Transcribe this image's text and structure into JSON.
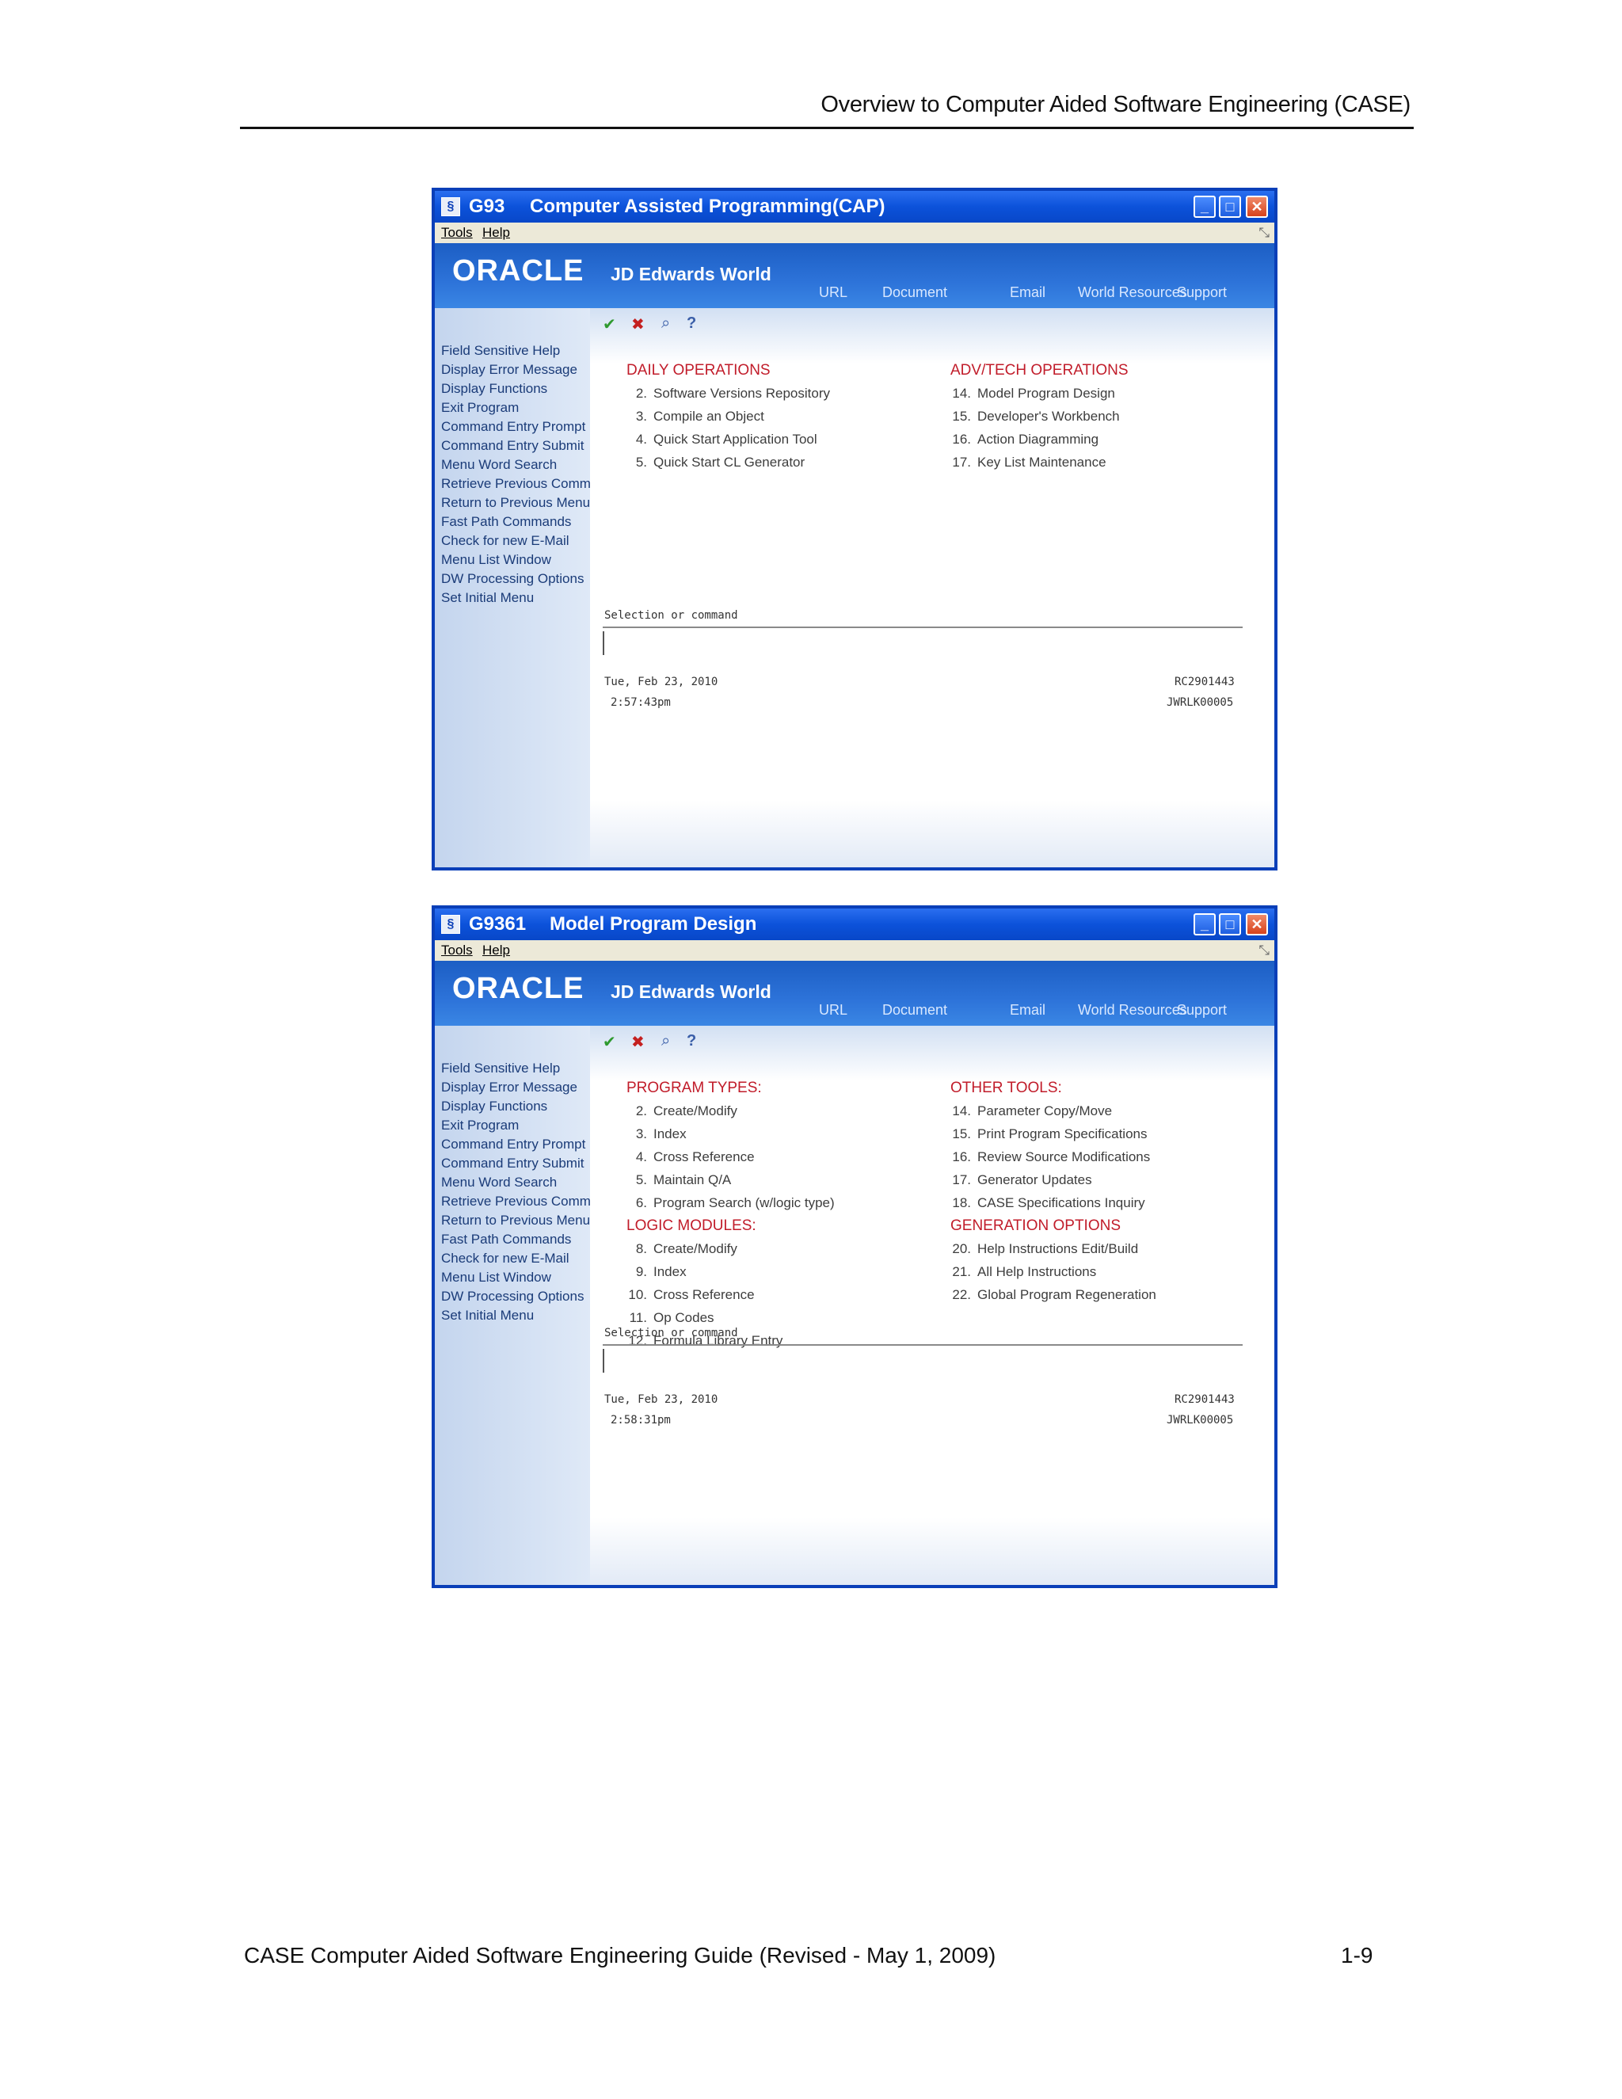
{
  "page": {
    "header": "Overview to Computer Aided Software Engineering (CASE)",
    "footer_left": "CASE Computer Aided Software Engineering Guide (Revised - May 1, 2009)",
    "footer_right": "1-9"
  },
  "common": {
    "menu": {
      "tools": "Tools",
      "help": "Help"
    },
    "brand": {
      "logo": "ORACLE",
      "product": "JD Edwards World"
    },
    "nav": {
      "url": "URL",
      "document": "Document",
      "email": "Email",
      "world_resources": "World Resources",
      "support": "Support"
    },
    "sidebar": [
      "Field Sensitive Help",
      "Display Error Message",
      "Display Functions",
      "Exit Program",
      "Command Entry Prompt",
      "Command Entry Submit",
      "Menu Word Search",
      "Retrieve Previous Command",
      "Return to Previous Menu",
      "Fast Path Commands",
      "Check for new E-Mail",
      "Menu List Window",
      "DW Processing Options",
      "Set Initial Menu"
    ],
    "selection_label": "Selection or command",
    "date": "Tue, Feb 23, 2010",
    "session_id": "RC2901443",
    "user_id": "JWRLK00005"
  },
  "window1": {
    "code": "G93",
    "title": "Computer Assisted Programming(CAP)",
    "time": "2:57:43pm",
    "left": [
      {
        "type": "section",
        "text": "DAILY OPERATIONS"
      },
      {
        "type": "item",
        "num": "2.",
        "text": "Software Versions Repository"
      },
      {
        "type": "item",
        "num": "3.",
        "text": "Compile an Object"
      },
      {
        "type": "item",
        "num": "4.",
        "text": "Quick Start Application Tool"
      },
      {
        "type": "item",
        "num": "5.",
        "text": "Quick Start CL Generator"
      }
    ],
    "right": [
      {
        "type": "section",
        "text": "ADV/TECH OPERATIONS"
      },
      {
        "type": "item",
        "num": "14.",
        "text": "Model Program Design"
      },
      {
        "type": "item",
        "num": "15.",
        "text": "Developer's Workbench"
      },
      {
        "type": "item",
        "num": "16.",
        "text": "Action Diagramming"
      },
      {
        "type": "item",
        "num": "17.",
        "text": "Key List Maintenance"
      }
    ]
  },
  "window2": {
    "code": "G9361",
    "title": "Model Program Design",
    "time": "2:58:31pm",
    "left": [
      {
        "type": "section",
        "text": "PROGRAM TYPES:"
      },
      {
        "type": "item",
        "num": "2.",
        "text": "Create/Modify"
      },
      {
        "type": "item",
        "num": "3.",
        "text": "Index"
      },
      {
        "type": "item",
        "num": "4.",
        "text": "Cross Reference"
      },
      {
        "type": "item",
        "num": "5.",
        "text": "Maintain Q/A"
      },
      {
        "type": "item",
        "num": "6.",
        "text": "Program Search (w/logic type)"
      },
      {
        "type": "section",
        "text": "LOGIC MODULES:"
      },
      {
        "type": "item",
        "num": "8.",
        "text": "Create/Modify"
      },
      {
        "type": "item",
        "num": "9.",
        "text": "Index"
      },
      {
        "type": "item",
        "num": "10.",
        "text": "Cross Reference"
      },
      {
        "type": "item",
        "num": "11.",
        "text": "Op Codes"
      },
      {
        "type": "item",
        "num": "12.",
        "text": "Formula Library Entry"
      }
    ],
    "right": [
      {
        "type": "section",
        "text": "OTHER TOOLS:"
      },
      {
        "type": "item",
        "num": "14.",
        "text": "Parameter Copy/Move"
      },
      {
        "type": "item",
        "num": "15.",
        "text": "Print Program Specifications"
      },
      {
        "type": "item",
        "num": "16.",
        "text": "Review Source Modifications"
      },
      {
        "type": "item",
        "num": "17.",
        "text": "Generator Updates"
      },
      {
        "type": "item",
        "num": "18.",
        "text": "CASE Specifications Inquiry"
      },
      {
        "type": "section",
        "text": "GENERATION OPTIONS"
      },
      {
        "type": "item",
        "num": "20.",
        "text": "Help Instructions Edit/Build"
      },
      {
        "type": "item",
        "num": "21.",
        "text": "All Help Instructions"
      },
      {
        "type": "item",
        "num": "22.",
        "text": "Global Program Regeneration"
      }
    ]
  }
}
